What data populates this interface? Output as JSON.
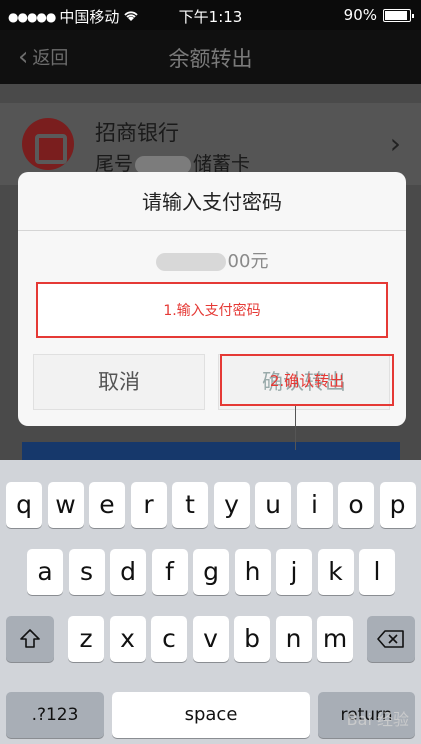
{
  "status_bar": {
    "carrier": "中国移动",
    "time": "下午1:13",
    "battery": "90%",
    "battery_level": 0.9
  },
  "nav": {
    "back_label": "返回",
    "title": "余额转出"
  },
  "card": {
    "bank_name": "招商银行",
    "prefix": "尾号",
    "card_type": "储蓄卡"
  },
  "dialog": {
    "title": "请输入支付密码",
    "amount_suffix": "00元",
    "password_annotation": "1.输入支付密码",
    "cancel_label": "取消",
    "confirm_label": "确认转出",
    "confirm_annotation": "2.确认转出"
  },
  "keyboard": {
    "row1": [
      "q",
      "w",
      "e",
      "r",
      "t",
      "y",
      "u",
      "i",
      "o",
      "p"
    ],
    "row2": [
      "a",
      "s",
      "d",
      "f",
      "g",
      "h",
      "j",
      "k",
      "l"
    ],
    "row3": [
      "z",
      "x",
      "c",
      "v",
      "b",
      "n",
      "m"
    ],
    "numbers_label": ".?123",
    "space_label": "space",
    "return_label": "return"
  },
  "watermark": "Bai 经验"
}
